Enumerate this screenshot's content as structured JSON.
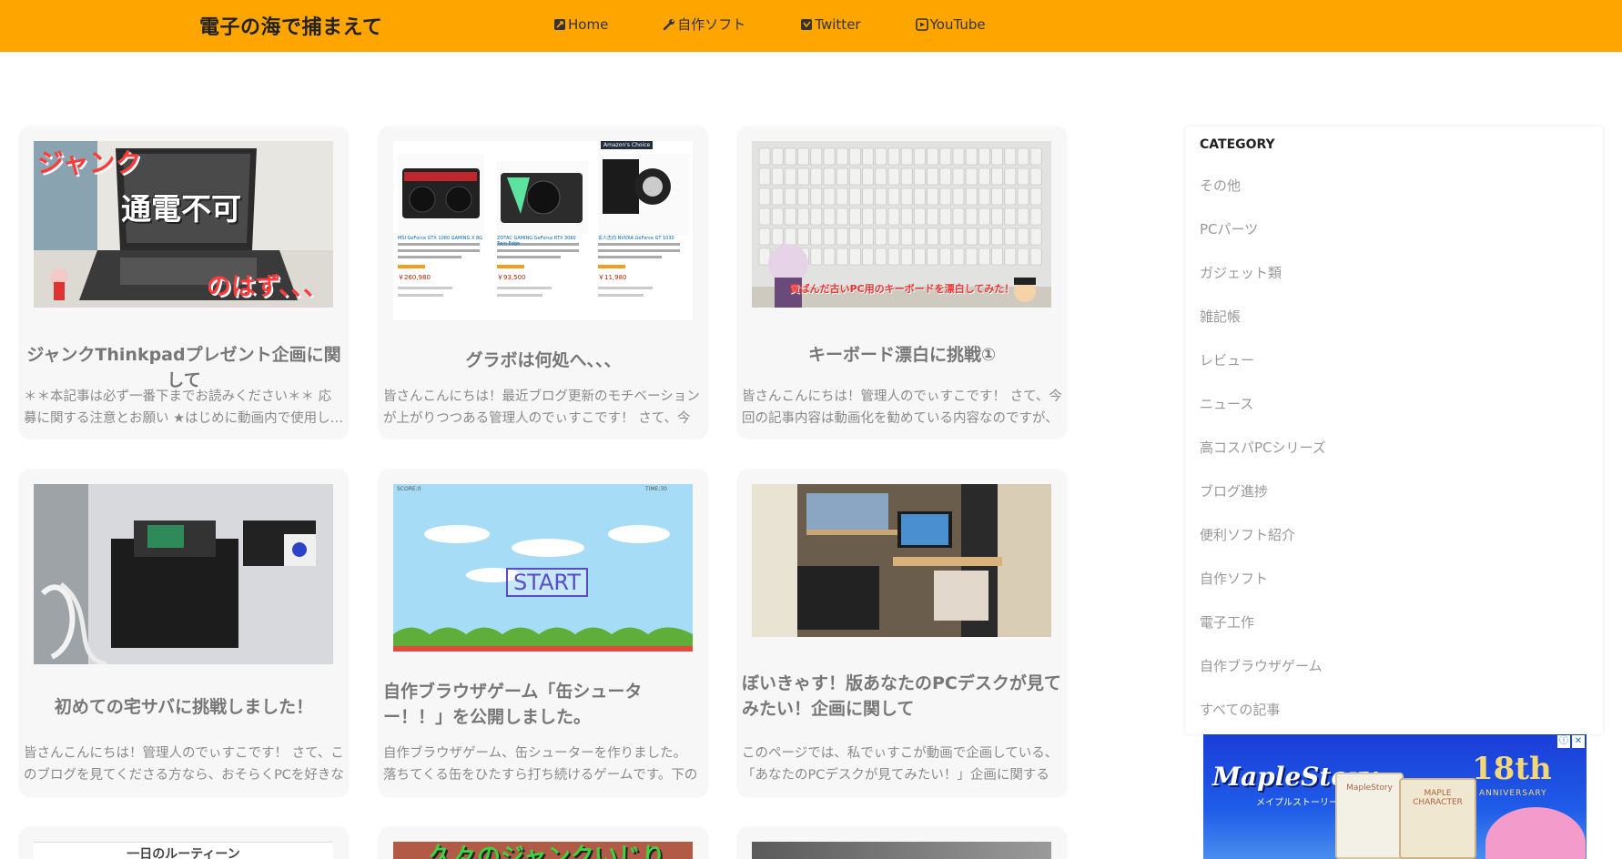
{
  "header": {
    "site_title": "電子の海で捕まえて",
    "nav": [
      {
        "label": "Home",
        "icon": "home-icon"
      },
      {
        "label": "自作ソフト",
        "icon": "wrench-icon"
      },
      {
        "label": "Twitter",
        "icon": "twitter-icon"
      },
      {
        "label": "YouTube",
        "icon": "youtube-icon"
      }
    ],
    "background_color": "#ffa500"
  },
  "cards": [
    {
      "title": "ジャンクThinkpadプレゼント企画に関して",
      "excerpt": "＊＊本記事は必ず一番下までお読みください＊＊ 応募に関する注意とお願い ★はじめに動画内で使用し…",
      "thumb_text": {
        "tag": "ジャンク",
        "main": "通電不可",
        "sub": "のはず、、、"
      }
    },
    {
      "title": "グラボは何処へ、、、",
      "excerpt": "皆さんこんにちは！最近ブログ更新のモチベーションが上がりつつある管理人のでぃすこです！ さて、今回の記事…",
      "thumb_text": {
        "banner": "Amazon's Choice",
        "prices": [
          "￥260,980",
          "￥93,500",
          "￥11,980"
        ],
        "products": [
          "MSI GeForce GTX 1080 GAMING X 8G",
          "ZOTAC GAMING GeForce RTX 3060 Twin Edge",
          "玄人志向 NVIDIA GeForce GT 1030"
        ]
      }
    },
    {
      "title": "キーボード漂白に挑戦①",
      "excerpt": "皆さんこんにちは！管理人のでぃすこです！ さて、今回の記事内容は動画化を勧めている内容なのですが、たま…",
      "thumb_text": {
        "caption": "黄ばんだ古いPC用のキーボードを漂白してみた！"
      }
    },
    {
      "title": "初めての宅サバに挑戦しました！",
      "excerpt": "皆さんこんにちは！管理人のでぃすこです！ さて、このブログを見てくださる方なら、おそらくPCを好きな方に違いは…"
    },
    {
      "title": "自作ブラウザゲーム「缶シューター！！」を公開しました。",
      "excerpt": "自作ブラウザゲーム、缶シューターを作りました。 落ちてくる缶をひたすら打ち続けるゲームです。下の赤いラインまで…",
      "thumb_text": {
        "button": "START",
        "hud_left": "SCORE:0",
        "hud_right": "TIME:30"
      }
    },
    {
      "title": "ぼいきゃす！版あなたのPCデスクが見てみたい！企画に関して",
      "excerpt": "このページでは、私でぃすこが動画で企画している、「あなたのPCデスクが見てみたい！」企画に関する詳細や、ご…"
    },
    {
      "title": "",
      "excerpt": "",
      "thumb_text": {
        "caption": "一日のルーティーン"
      }
    },
    {
      "title": "",
      "excerpt": "",
      "thumb_text": {
        "caption": "久々のジャンクいじり"
      }
    },
    {
      "title": "",
      "excerpt": ""
    }
  ],
  "sidebar": {
    "heading": "CATEGORY",
    "categories": [
      "その他",
      "PCパーツ",
      "ガジェット類",
      "雑記帳",
      "レビュー",
      "ニュース",
      "高コスパPCシリーズ",
      "ブログ進捗",
      "便利ソフト紹介",
      "自作ソフト",
      "電子工作",
      "自作ブラウザゲーム",
      "すべての記事"
    ]
  },
  "ad": {
    "brand": "MapleStory",
    "brand_sub": "メイプルストーリー",
    "anniversary": "18th",
    "anniversary_sub": "ANNIVERSARY",
    "box_labels": [
      "MapleStory",
      "MAPLE CHARACTER"
    ],
    "info_icon": "ⓘ",
    "close_icon": "✕"
  }
}
